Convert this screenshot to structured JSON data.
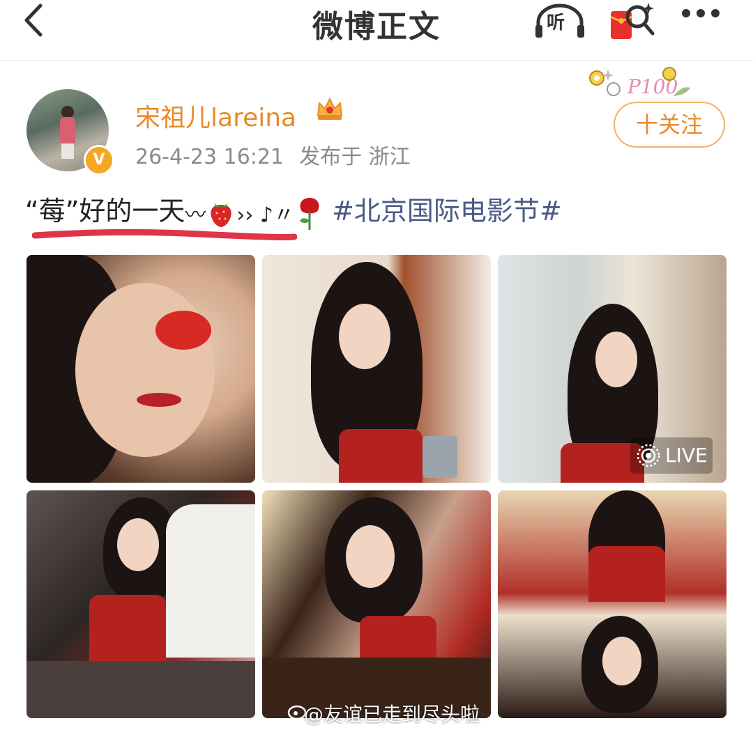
{
  "header": {
    "title": "微博正文",
    "listen_label": "听"
  },
  "author": {
    "name": "宋祖儿lareina",
    "verified_mark": "V",
    "time": "26-4-23 16:21",
    "location": "发布于 浙江",
    "follow_label": "十关注"
  },
  "post": {
    "quote_open": "“",
    "highlight": "莓",
    "quote_close": "”",
    "text": "好的一天",
    "tilde": "〰",
    "after_emoji": "›› ♪〃",
    "hashtag": "#北京国际电影节#"
  },
  "photos": {
    "count": 6,
    "live_label": "LIVE"
  },
  "watermark": {
    "text": "@友谊已走到尽头啦"
  },
  "colors": {
    "accent_orange": "#e98a2a",
    "hashtag_blue": "#4a5a86",
    "underline_red": "#e0344a"
  },
  "icons": [
    "back-icon",
    "headphones-icon",
    "red-packet-icon",
    "more-icon",
    "crown-icon",
    "verified-badge-icon",
    "strawberry-icon",
    "rose-icon",
    "live-icon",
    "weibo-icon"
  ]
}
